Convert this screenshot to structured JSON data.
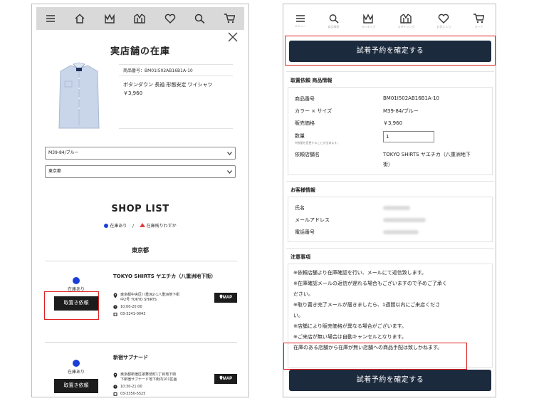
{
  "left": {
    "store_title": "実店舗の在庫",
    "product": {
      "code": "商品番号：BM01I502AB16B1A-10",
      "name": "ボタンダウン 長袖 形態安定 ワイシャツ",
      "price": "￥3,960"
    },
    "select_color": "M39-84/ブルー",
    "select_region": "東京都",
    "shoplist_title": "SHOP LIST",
    "legend": {
      "in_stock": "在庫あり",
      "separator": "/",
      "few_left": "在庫残りわずか"
    },
    "region_label": "東京都",
    "shops": [
      {
        "status": "在庫あり",
        "button": "取置き依頼",
        "name": "TOKYO SHIRTS ヤエチカ（八重洲地下街）",
        "address_1": "東京都中央区八重洲2-1八重洲地下街",
        "address_2": "中2号 TOKYO SHIRTS",
        "hours": "10:00-20:00",
        "phone": "03-3241-0043",
        "map": "MAP"
      },
      {
        "status": "在庫あり",
        "button": "取置き依頼",
        "name": "新宿サブナード",
        "address_1": "東京都新宿区歌舞伎町1丁目地下街",
        "address_2": "下新宿サブナード地下街内101区画",
        "hours": "10:30-21:00",
        "phone": "03-3350-5525",
        "map": "MAP"
      }
    ]
  },
  "right": {
    "nav": [
      "メニュー",
      "商品検索",
      "ランキング",
      "スタイリング",
      "お気に入り",
      "カート"
    ],
    "confirm_label": "試着予約を確定する",
    "order_section": {
      "title": "取置依頼 商品情報",
      "rows": [
        {
          "label": "商品番号",
          "value": "BM01I502AB16B1A-10"
        },
        {
          "label": "カラー × サイズ",
          "value": "M39-84/ブルー"
        },
        {
          "label": "販売価格",
          "value": "￥3,960"
        }
      ],
      "qty_label": "数量",
      "qty_note": "※数量を変更することが出来ます。",
      "qty_value": "1",
      "shop_label": "依頼店舗名",
      "shop_value_1": "TOKYO SHIRTS ヤエチカ（八重洲地下",
      "shop_value_2": "街）"
    },
    "customer_section": {
      "title": "お客様情報",
      "rows": [
        "氏名",
        "メールアドレス",
        "電話番号"
      ]
    },
    "notes_section": {
      "title": "注意事項",
      "lines": [
        "※依頼店舗より在庫確認を行い、メールにて返信致します。",
        "※在庫確認メールの返信が遅れる場合もございますので予めご了承く",
        "ださい。",
        "※取り置き完了メールが届きましたら、1週間以内にご来店くださ",
        "い。",
        "※店舗により販売価格が異なる場合がございます。",
        "※ご来店が無い場合は自動キャンセルとなります。",
        "在庫のある店舗から在庫が無い店舗への商品手配は致しかねます。"
      ]
    }
  },
  "colors": {
    "confirm_button": "#1c2a3e",
    "highlight": "#e02020",
    "in_stock_dot": "#1a3fd9",
    "few_left_triangle": "#e04040"
  }
}
